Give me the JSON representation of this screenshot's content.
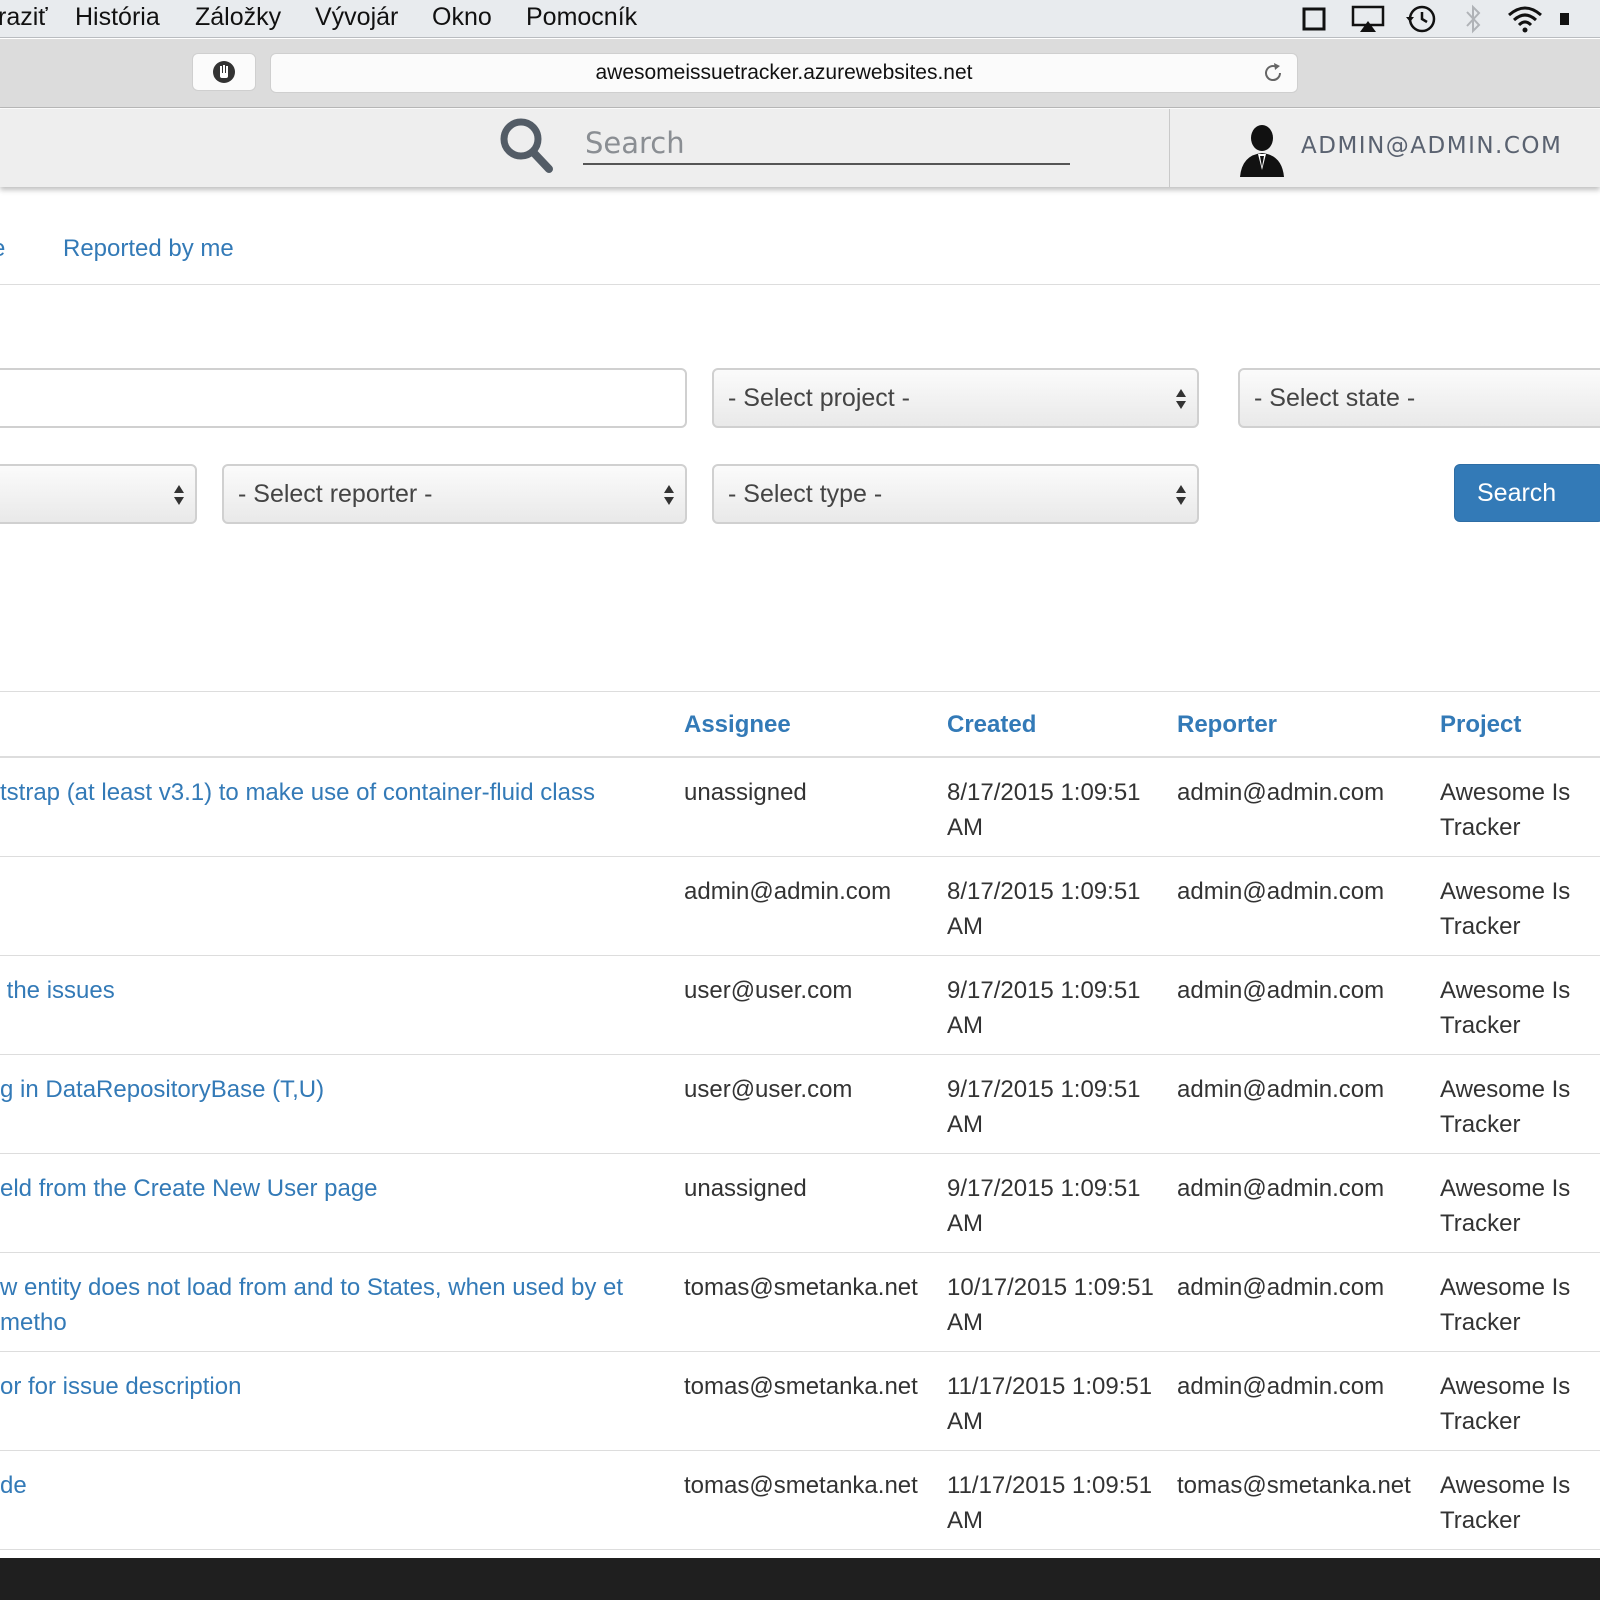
{
  "menubar": {
    "items": [
      "raziť",
      "História",
      "Záložky",
      "Vývojár",
      "Okno",
      "Pomocník"
    ],
    "status_icons": [
      "window-icon",
      "airplay-icon",
      "time-machine-icon",
      "bluetooth-icon",
      "wifi-icon",
      "battery-icon"
    ]
  },
  "browser": {
    "url": "awesomeissuetracker.azurewebsites.net"
  },
  "header": {
    "search_placeholder": "Search",
    "user_email": "ADMIN@ADMIN.COM"
  },
  "tabs": [
    {
      "label": "e"
    },
    {
      "label": "Reported by me"
    }
  ],
  "filters": {
    "text_value": "",
    "project_select": "- Select project -",
    "state_select": "- Select state -",
    "first_select": "",
    "reporter_select": "- Select reporter -",
    "type_select": "- Select type -",
    "search_button": "Search"
  },
  "table": {
    "columns": {
      "assignee": "Assignee",
      "created": "Created",
      "reporter": "Reporter",
      "project": "Project"
    },
    "rows": [
      {
        "title": "tstrap (at least v3.1) to make use of container-fluid class",
        "assignee": "unassigned",
        "created": "8/17/2015 1:09:51 AM",
        "reporter": "admin@admin.com",
        "project_line1": "Awesome Is",
        "project_line2": "Tracker"
      },
      {
        "title": "",
        "assignee": "admin@admin.com",
        "created": "8/17/2015 1:09:51 AM",
        "reporter": "admin@admin.com",
        "project_line1": "Awesome Is",
        "project_line2": "Tracker"
      },
      {
        "title": " the issues",
        "assignee": "user@user.com",
        "created": "9/17/2015 1:09:51 AM",
        "reporter": "admin@admin.com",
        "project_line1": "Awesome Is",
        "project_line2": "Tracker"
      },
      {
        "title": "g in DataRepositoryBase (T,U)",
        "assignee": "user@user.com",
        "created": "9/17/2015 1:09:51 AM",
        "reporter": "admin@admin.com",
        "project_line1": "Awesome Is",
        "project_line2": "Tracker"
      },
      {
        "title": "eld from the Create New User page",
        "assignee": "unassigned",
        "created": "9/17/2015 1:09:51 AM",
        "reporter": "admin@admin.com",
        "project_line1": "Awesome Is",
        "project_line2": "Tracker"
      },
      {
        "title": "w entity does not load from and to States, when used by et metho",
        "assignee": "tomas@smetanka.net",
        "created": "10/17/2015 1:09:51 AM",
        "reporter": "admin@admin.com",
        "project_line1": "Awesome Is",
        "project_line2": "Tracker"
      },
      {
        "title": "or for issue description",
        "assignee": "tomas@smetanka.net",
        "created": "11/17/2015 1:09:51 AM",
        "reporter": "admin@admin.com",
        "project_line1": "Awesome Is",
        "project_line2": "Tracker"
      },
      {
        "title": "de",
        "assignee": "tomas@smetanka.net",
        "created": "11/17/2015 1:09:51 AM",
        "reporter": "tomas@smetanka.net",
        "project_line1": "Awesome Is",
        "project_line2": "Tracker"
      }
    ]
  }
}
